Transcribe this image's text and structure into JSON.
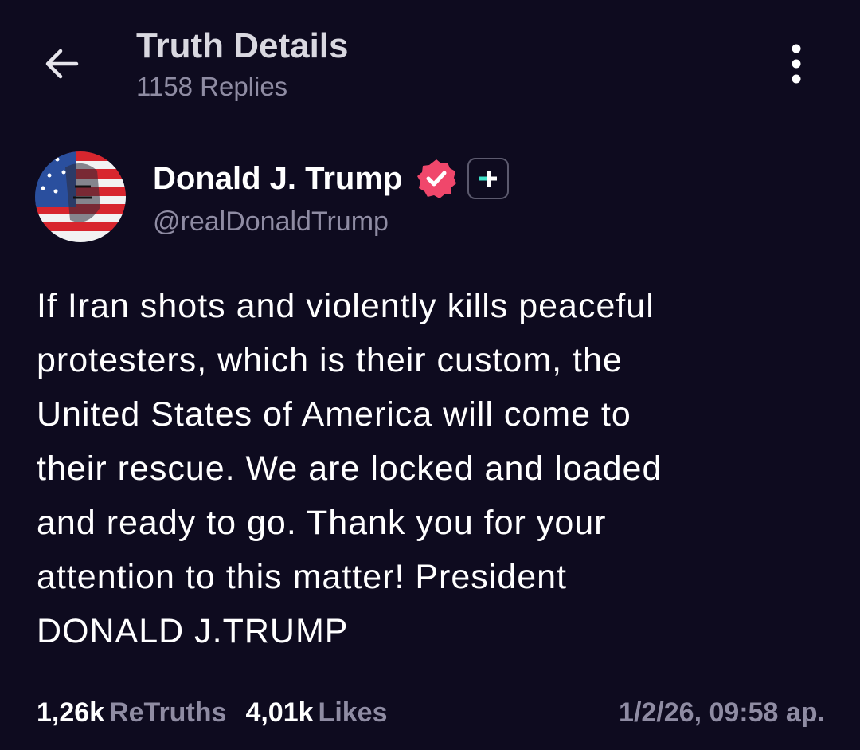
{
  "header": {
    "title": "Truth Details",
    "replies": "1158 Replies",
    "back_icon": "arrow-left-icon",
    "menu_icon": "kebab-menu-icon"
  },
  "author": {
    "display_name": "Donald J. Trump",
    "handle": "@realDonaldTrump",
    "verified_icon": "verified-badge-icon",
    "plus_icon": "plus-badge-icon",
    "verified_color": "#f0476b",
    "plus_color": "#3fe0c8"
  },
  "post": {
    "text": "If Iran shots and violently kills peaceful\nprotesters, which is their custom, the\nUnited States of America will come to\ntheir rescue. We are locked and loaded\nand ready to go. Thank you for your\nattention to this matter! President\nDONALD J.TRUMP"
  },
  "stats": {
    "retruths_count": "1,26k",
    "retruths_label": "ReTruths",
    "likes_count": "4,01k",
    "likes_label": "Likes",
    "timestamp": "1/2/26, 09:58 ap."
  },
  "colors": {
    "background": "#0e0b1f",
    "text": "#ffffff",
    "muted": "#8f8ca3"
  }
}
